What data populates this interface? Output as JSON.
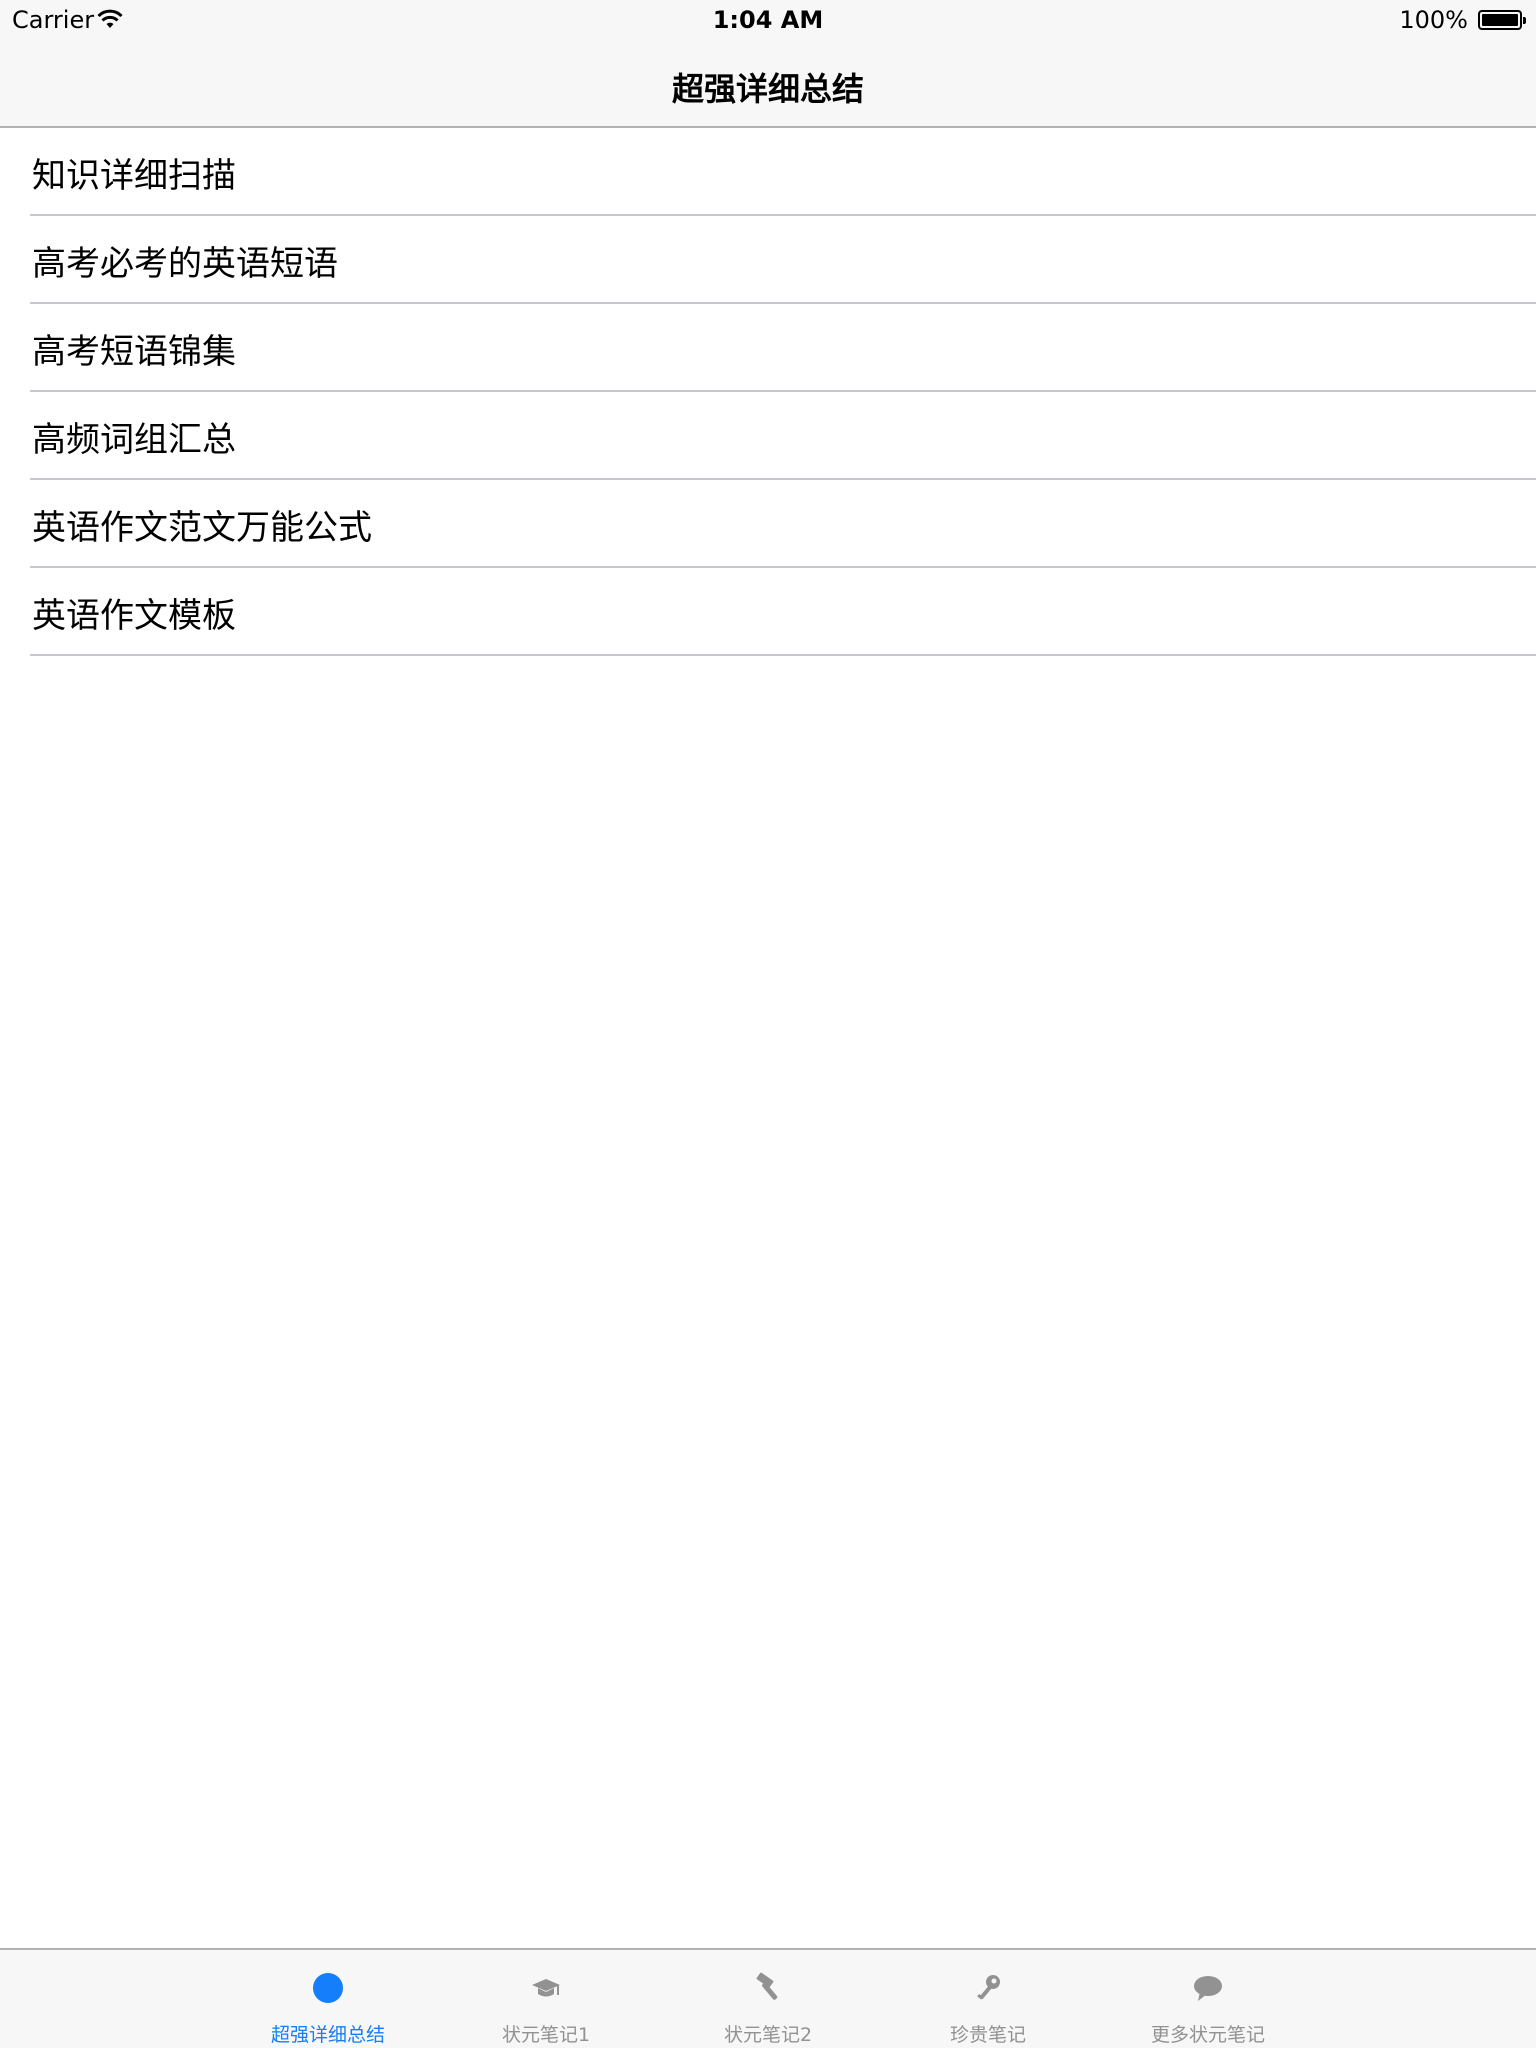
{
  "status_bar": {
    "carrier": "Carrier",
    "time": "1:04 AM",
    "battery": "100%",
    "wifi_icon": "wifi-icon",
    "battery_icon": "battery-icon"
  },
  "nav": {
    "title": "超强详细总结"
  },
  "list": {
    "items": [
      {
        "label": "知识详细扫描"
      },
      {
        "label": "高考必考的英语短语"
      },
      {
        "label": "高考短语锦集"
      },
      {
        "label": "高频词组汇总"
      },
      {
        "label": "英语作文范文万能公式"
      },
      {
        "label": "英语作文模板"
      }
    ]
  },
  "tabs": [
    {
      "label": "超强详细总结",
      "icon": "circle-icon",
      "active": true
    },
    {
      "label": "状元笔记1",
      "icon": "graduation-cap-icon",
      "active": false
    },
    {
      "label": "状元笔记2",
      "icon": "hammer-icon",
      "active": false
    },
    {
      "label": "珍贵笔记",
      "icon": "key-icon",
      "active": false
    },
    {
      "label": "更多状元笔记",
      "icon": "speech-bubble-icon",
      "active": false
    }
  ],
  "colors": {
    "accent": "#147efb",
    "inactive": "#929292",
    "separator": "#c8c7cc",
    "bar_background": "#f7f7f7"
  }
}
